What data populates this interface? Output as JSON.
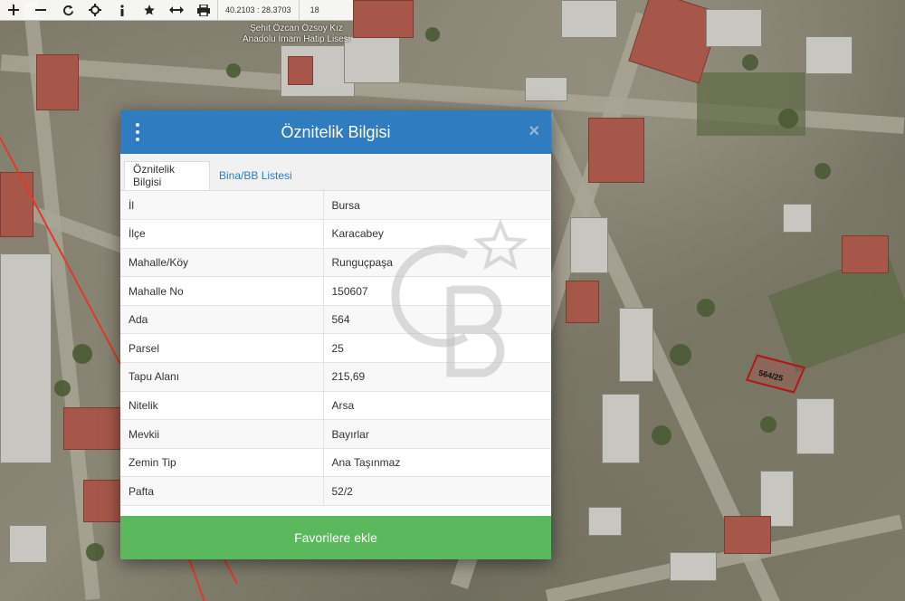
{
  "toolbar": {
    "coordinates": "40.2103 : 28.3703",
    "zoom_level": "18",
    "icons": [
      "plus-icon",
      "minus-icon",
      "refresh-icon",
      "crosshair-icon",
      "info-icon",
      "star-icon",
      "measure-icon",
      "print-icon"
    ]
  },
  "map": {
    "school_label_line1": "Şehit Özcan Özsoy Kız",
    "school_label_line2": "Anadolu İmam Hatip Lisesi",
    "parcel_label": "564/25"
  },
  "modal": {
    "title": "Öznitelik Bilgisi",
    "tabs": [
      {
        "label": "Öznitelik Bilgisi",
        "active": true
      },
      {
        "label": "Bina/BB Listesi",
        "active": false
      }
    ],
    "rows": [
      {
        "key": "İl",
        "value": "Bursa"
      },
      {
        "key": "İlçe",
        "value": "Karacabey"
      },
      {
        "key": "Mahalle/Köy",
        "value": "Runguçpaşa"
      },
      {
        "key": "Mahalle No",
        "value": "150607"
      },
      {
        "key": "Ada",
        "value": "564"
      },
      {
        "key": "Parsel",
        "value": "25"
      },
      {
        "key": "Tapu Alanı",
        "value": "215,69"
      },
      {
        "key": "Nitelik",
        "value": "Arsa"
      },
      {
        "key": "Mevkii",
        "value": "Bayırlar"
      },
      {
        "key": "Zemin Tip",
        "value": "Ana Taşınmaz"
      },
      {
        "key": "Pafta",
        "value": "52/2"
      }
    ],
    "favorite_button": "Favorilere ekle"
  },
  "colors": {
    "header_blue": "#2f7cc0",
    "button_green": "#5cb85c",
    "parcel_outline": "#b01818",
    "boundary_red": "#e03a2a"
  }
}
